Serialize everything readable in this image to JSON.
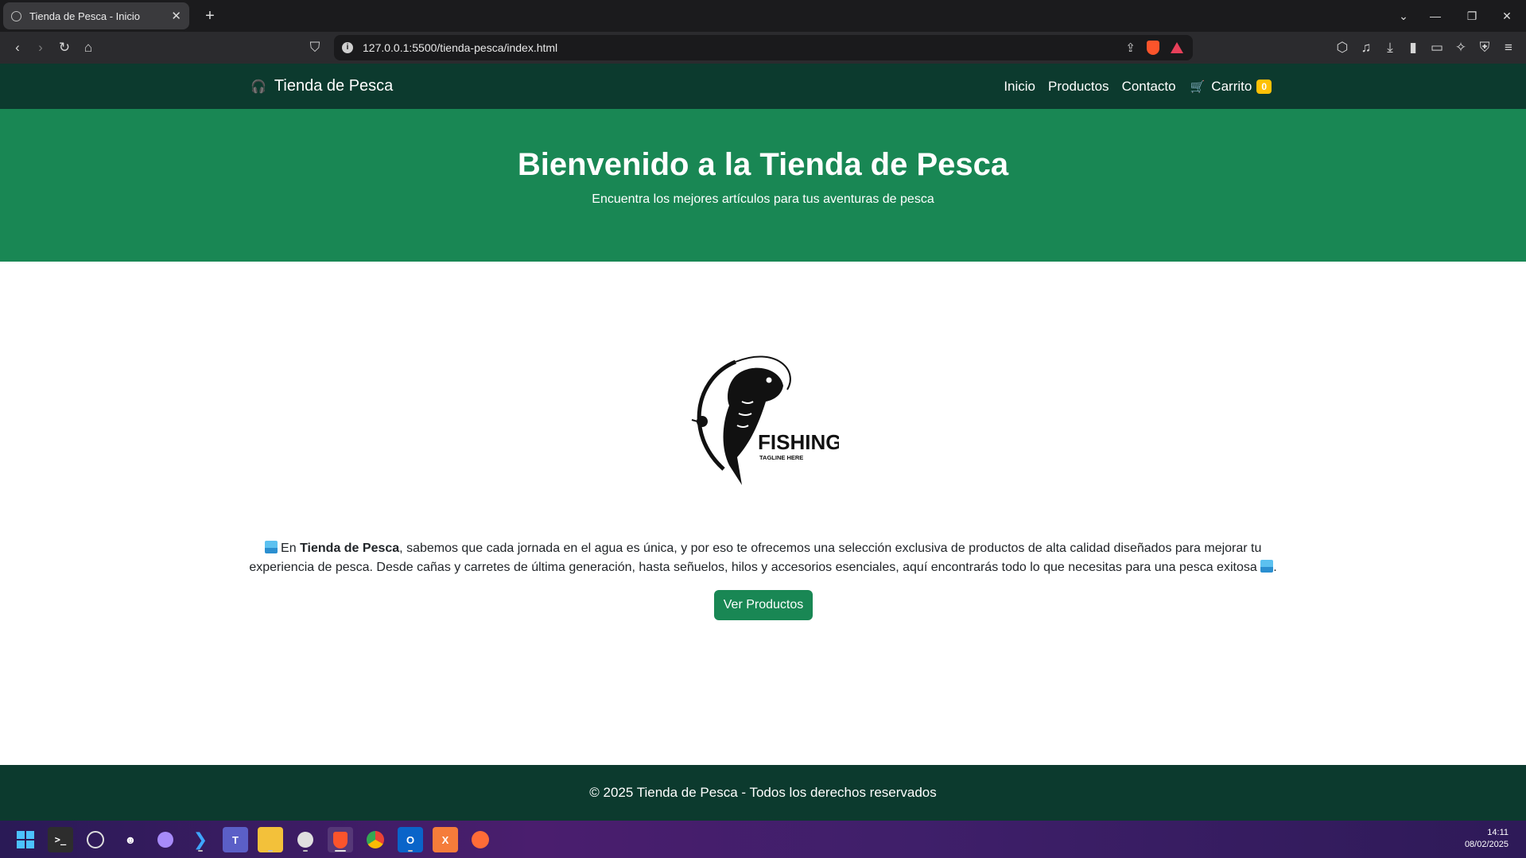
{
  "browser": {
    "tab_title": "Tienda de Pesca - Inicio",
    "url": "127.0.0.1:5500/tienda-pesca/index.html"
  },
  "site": {
    "brand": "Tienda de Pesca",
    "brand_icon": "🎧",
    "nav": [
      "Inicio",
      "Productos",
      "Contacto"
    ],
    "cart_label": "Carrito",
    "cart_icon": "🛒",
    "cart_count": "0"
  },
  "hero": {
    "title": "Bienvenido a la Tienda de Pesca",
    "subtitle": "Encuentra los mejores artículos para tus aventuras de pesca"
  },
  "logo": {
    "title": "FISHING",
    "tagline": "TAGLINE HERE"
  },
  "intro": {
    "pre": " En ",
    "strong": "Tienda de Pesca",
    "text": ", sabemos que cada jornada en el agua es única, y por eso te ofrecemos una selección exclusiva de productos de alta calidad diseñados para mejorar tu experiencia de pesca. Desde cañas y carretes de última generación, hasta señuelos, hilos y accesorios esenciales, aquí encontrarás todo lo que necesitas para una pesca exitosa ",
    "end": "."
  },
  "cta_label": "Ver Productos",
  "footer": "© 2025 Tienda de Pesca - Todos los derechos reservados",
  "taskbar": {
    "time": "14:11",
    "date": "08/02/2025"
  },
  "colors": {
    "navbar": "#0c3a2e",
    "hero": "#198754",
    "badge": "#ffc107"
  }
}
